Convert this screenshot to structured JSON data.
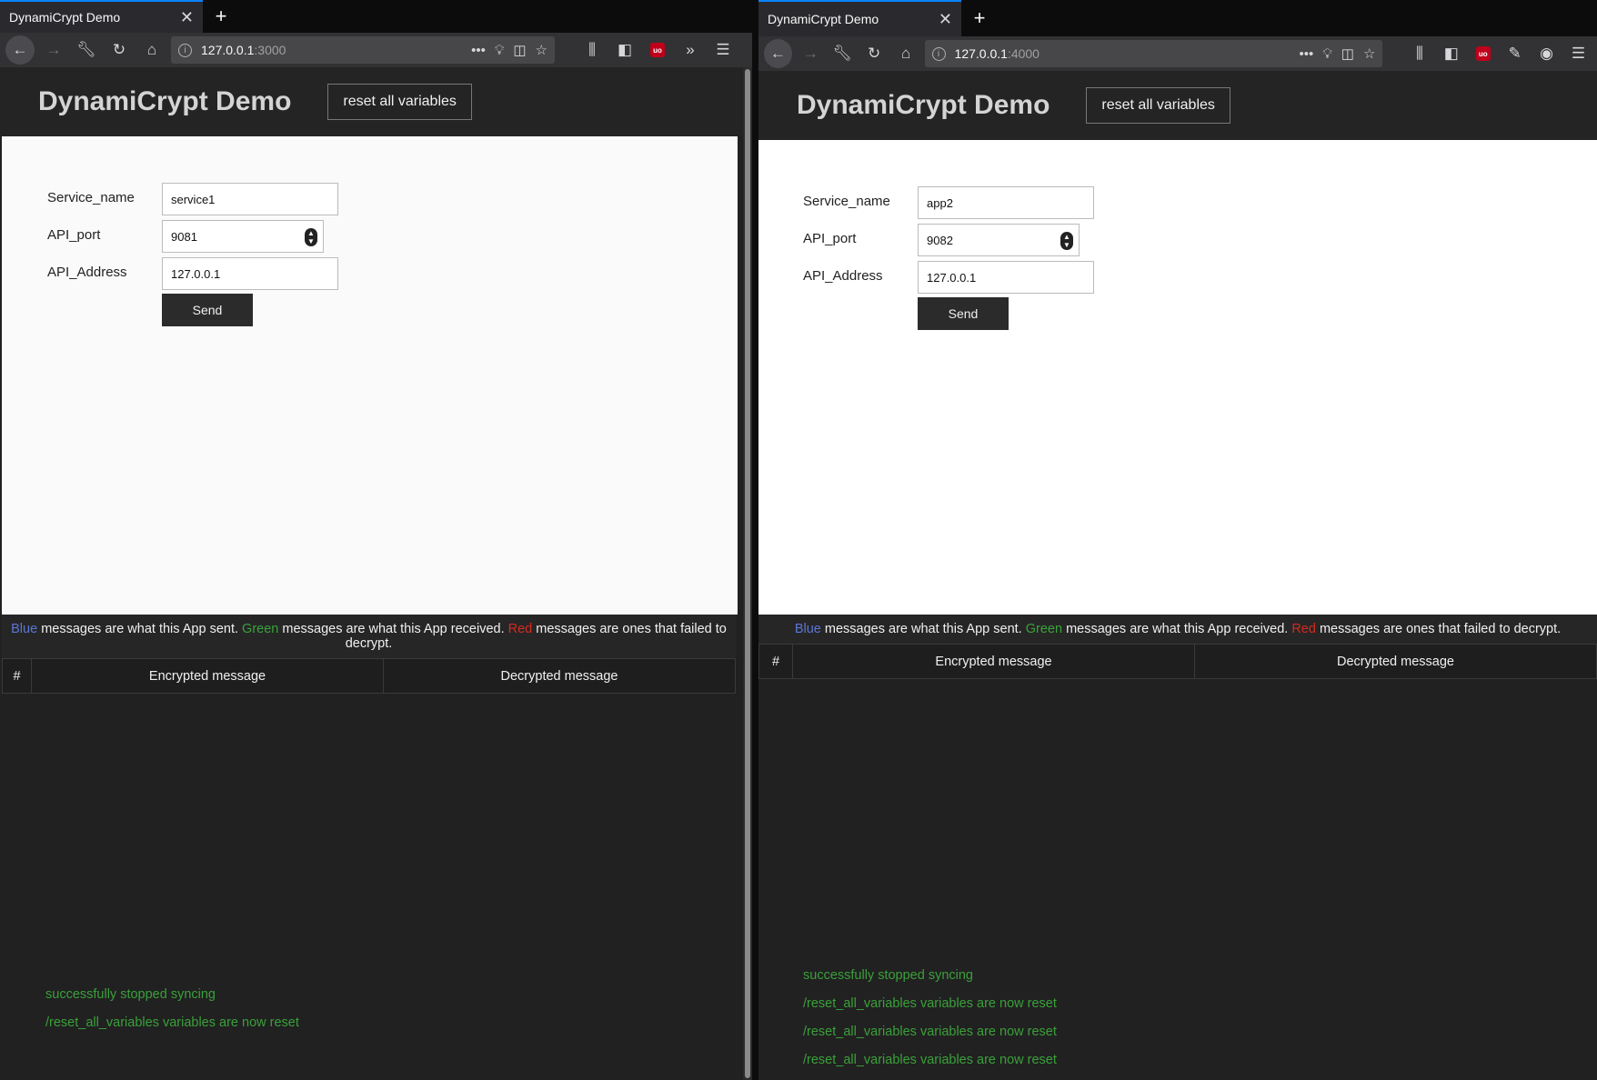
{
  "left": {
    "tab_title": "DynamiCrypt Demo",
    "url_host": "127.0.0.1",
    "url_port": ":3000",
    "app_title": "DynamiCrypt Demo",
    "reset_label": "reset all variables",
    "form": {
      "service_name_label": "Service_name",
      "service_name_value": "service1",
      "api_port_label": "API_port",
      "api_port_value": "9081",
      "api_address_label": "API_Address",
      "api_address_value": "127.0.0.1",
      "send_label": "Send"
    },
    "legend": {
      "blue": "Blue",
      "t1": " messages are what this App sent. ",
      "green": "Green",
      "t2": " messages are what this App received. ",
      "red": "Red",
      "t3": " messages are ones that failed to decrypt."
    },
    "table": {
      "col_num": "#",
      "col_enc": "Encrypted message",
      "col_dec": "Decrypted message"
    },
    "log": [
      "successfully stopped syncing",
      "/reset_all_variables variables are now reset"
    ]
  },
  "right": {
    "tab_title": "DynamiCrypt Demo",
    "url_host": "127.0.0.1",
    "url_port": ":4000",
    "app_title": "DynamiCrypt Demo",
    "reset_label": "reset all variables",
    "form": {
      "service_name_label": "Service_name",
      "service_name_value": "app2",
      "api_port_label": "API_port",
      "api_port_value": "9082",
      "api_address_label": "API_Address",
      "api_address_value": "127.0.0.1",
      "send_label": "Send"
    },
    "legend": {
      "blue": "Blue",
      "t1": " messages are what this App sent. ",
      "green": "Green",
      "t2": " messages are what this App received. ",
      "red": "Red",
      "t3": " messages are ones that failed to decrypt."
    },
    "table": {
      "col_num": "#",
      "col_enc": "Encrypted message",
      "col_dec": "Decrypted message"
    },
    "log": [
      "successfully stopped syncing",
      "/reset_all_variables variables are now reset",
      "/reset_all_variables variables are now reset",
      "/reset_all_variables variables are now reset"
    ]
  },
  "colors": {
    "blue_msg": "#5b77d6",
    "green_msg": "#39a33a",
    "red_msg": "#d42a1f",
    "tab_accent": "#0a84ff"
  },
  "icons": [
    "back-icon",
    "forward-icon",
    "wrench-icon",
    "reload-icon",
    "home-icon",
    "info-icon",
    "more-icon",
    "lightbulb-icon",
    "pocket-icon",
    "star-icon",
    "library-icon",
    "sidebar-icon",
    "ublock-icon",
    "overflow-icon",
    "menu-icon"
  ]
}
